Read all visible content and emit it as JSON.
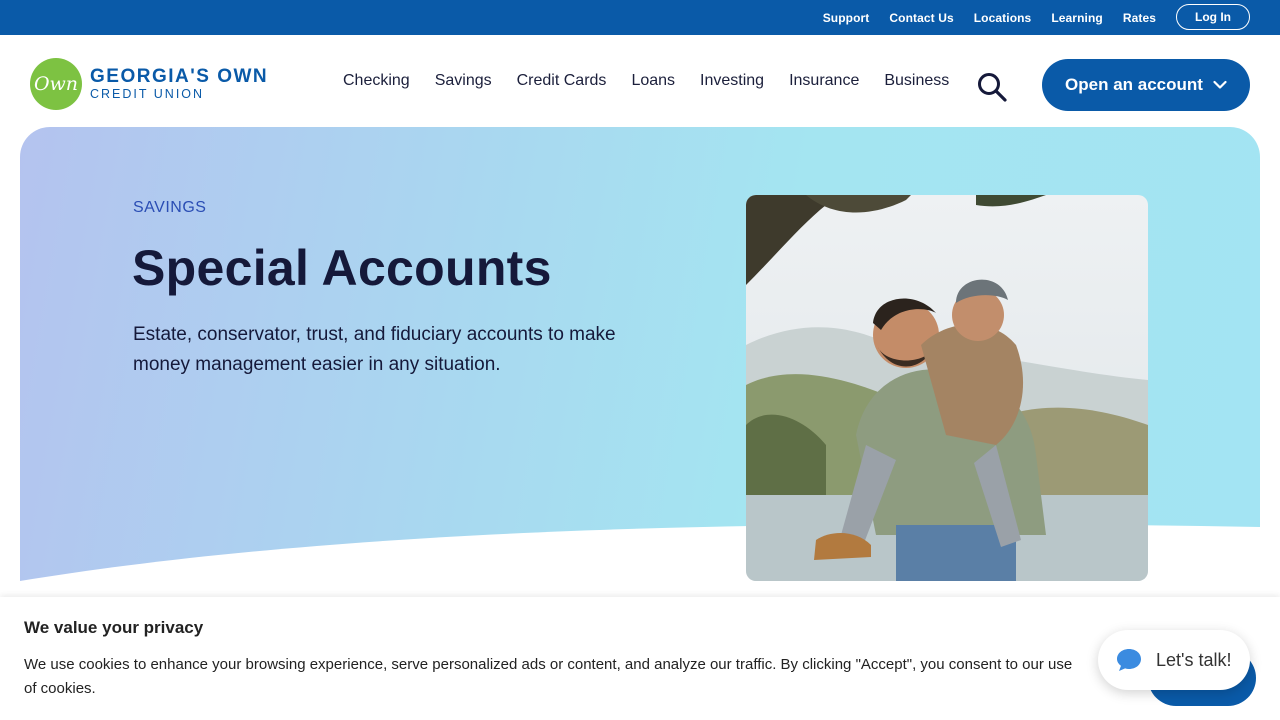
{
  "utility_nav": {
    "links": [
      "Support",
      "Contact Us",
      "Locations",
      "Learning",
      "Rates"
    ],
    "login_label": "Log In"
  },
  "brand": {
    "logo_mark": "Own",
    "name_line1": "GEORGIA'S OWN",
    "name_line2": "CREDIT UNION",
    "primary_color": "#0a5aa8",
    "logo_color": "#7dc242"
  },
  "main_nav": {
    "items": [
      "Checking",
      "Savings",
      "Credit Cards",
      "Loans",
      "Investing",
      "Insurance",
      "Business"
    ],
    "search_icon": "search-icon",
    "cta_label": "Open an account"
  },
  "hero": {
    "eyebrow": "SAVINGS",
    "title": "Special Accounts",
    "description": "Estate, conservator, trust, and fiduciary accounts to make money management easier in any situation.",
    "image_icon": "photo-father-son-piggyback"
  },
  "cookie_banner": {
    "title": "We value your privacy",
    "text": "We use cookies to enhance your browsing experience, serve personalized ads or content, and analyze our traffic. By clicking \"Accept\", you consent to our use of cookies."
  },
  "chat": {
    "label": "Let's talk!",
    "icon": "chat-bubble-icon"
  }
}
